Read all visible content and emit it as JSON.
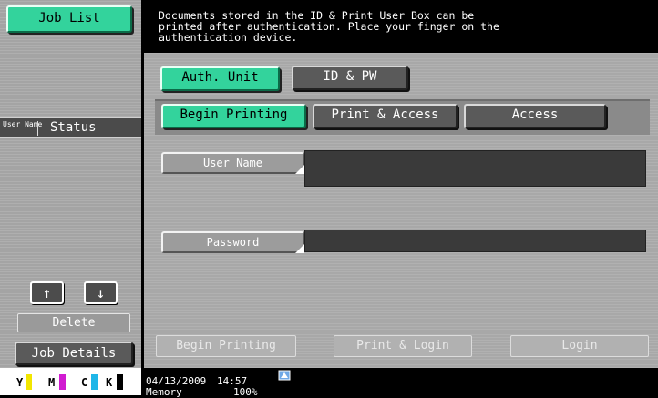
{
  "left_panel": {
    "job_list_label": "Job List",
    "col_user_name": "User Name",
    "col_status": "Status",
    "delete_label": "Delete",
    "job_details_label": "Job Details",
    "toner": [
      {
        "letter": "Y",
        "color": "#f2e600"
      },
      {
        "letter": "M",
        "color": "#d11bd1"
      },
      {
        "letter": "C",
        "color": "#1fb6e8"
      },
      {
        "letter": "K",
        "color": "#000000"
      }
    ]
  },
  "message": "Documents stored in the ID & Print User Box can be\nprinted after authentication. Place your finger on the\nauthentication device.",
  "auth_tabs": {
    "auth_unit": "Auth. Unit",
    "id_pw": "ID & PW"
  },
  "print_tabs": {
    "begin_printing": "Begin Printing",
    "print_access": "Print & Access",
    "access": "Access"
  },
  "fields": {
    "user_name_label": "User Name",
    "password_label": "Password"
  },
  "bottom_buttons": {
    "begin_printing": "Begin Printing",
    "print_login": "Print & Login",
    "login": "Login"
  },
  "status_bar": {
    "date": "04/13/2009",
    "time": "14:57",
    "memory_label": "Memory",
    "memory_value": "100%"
  },
  "colors": {
    "accent_green": "#33d39c",
    "panel_gray": "#a8a8a8"
  }
}
